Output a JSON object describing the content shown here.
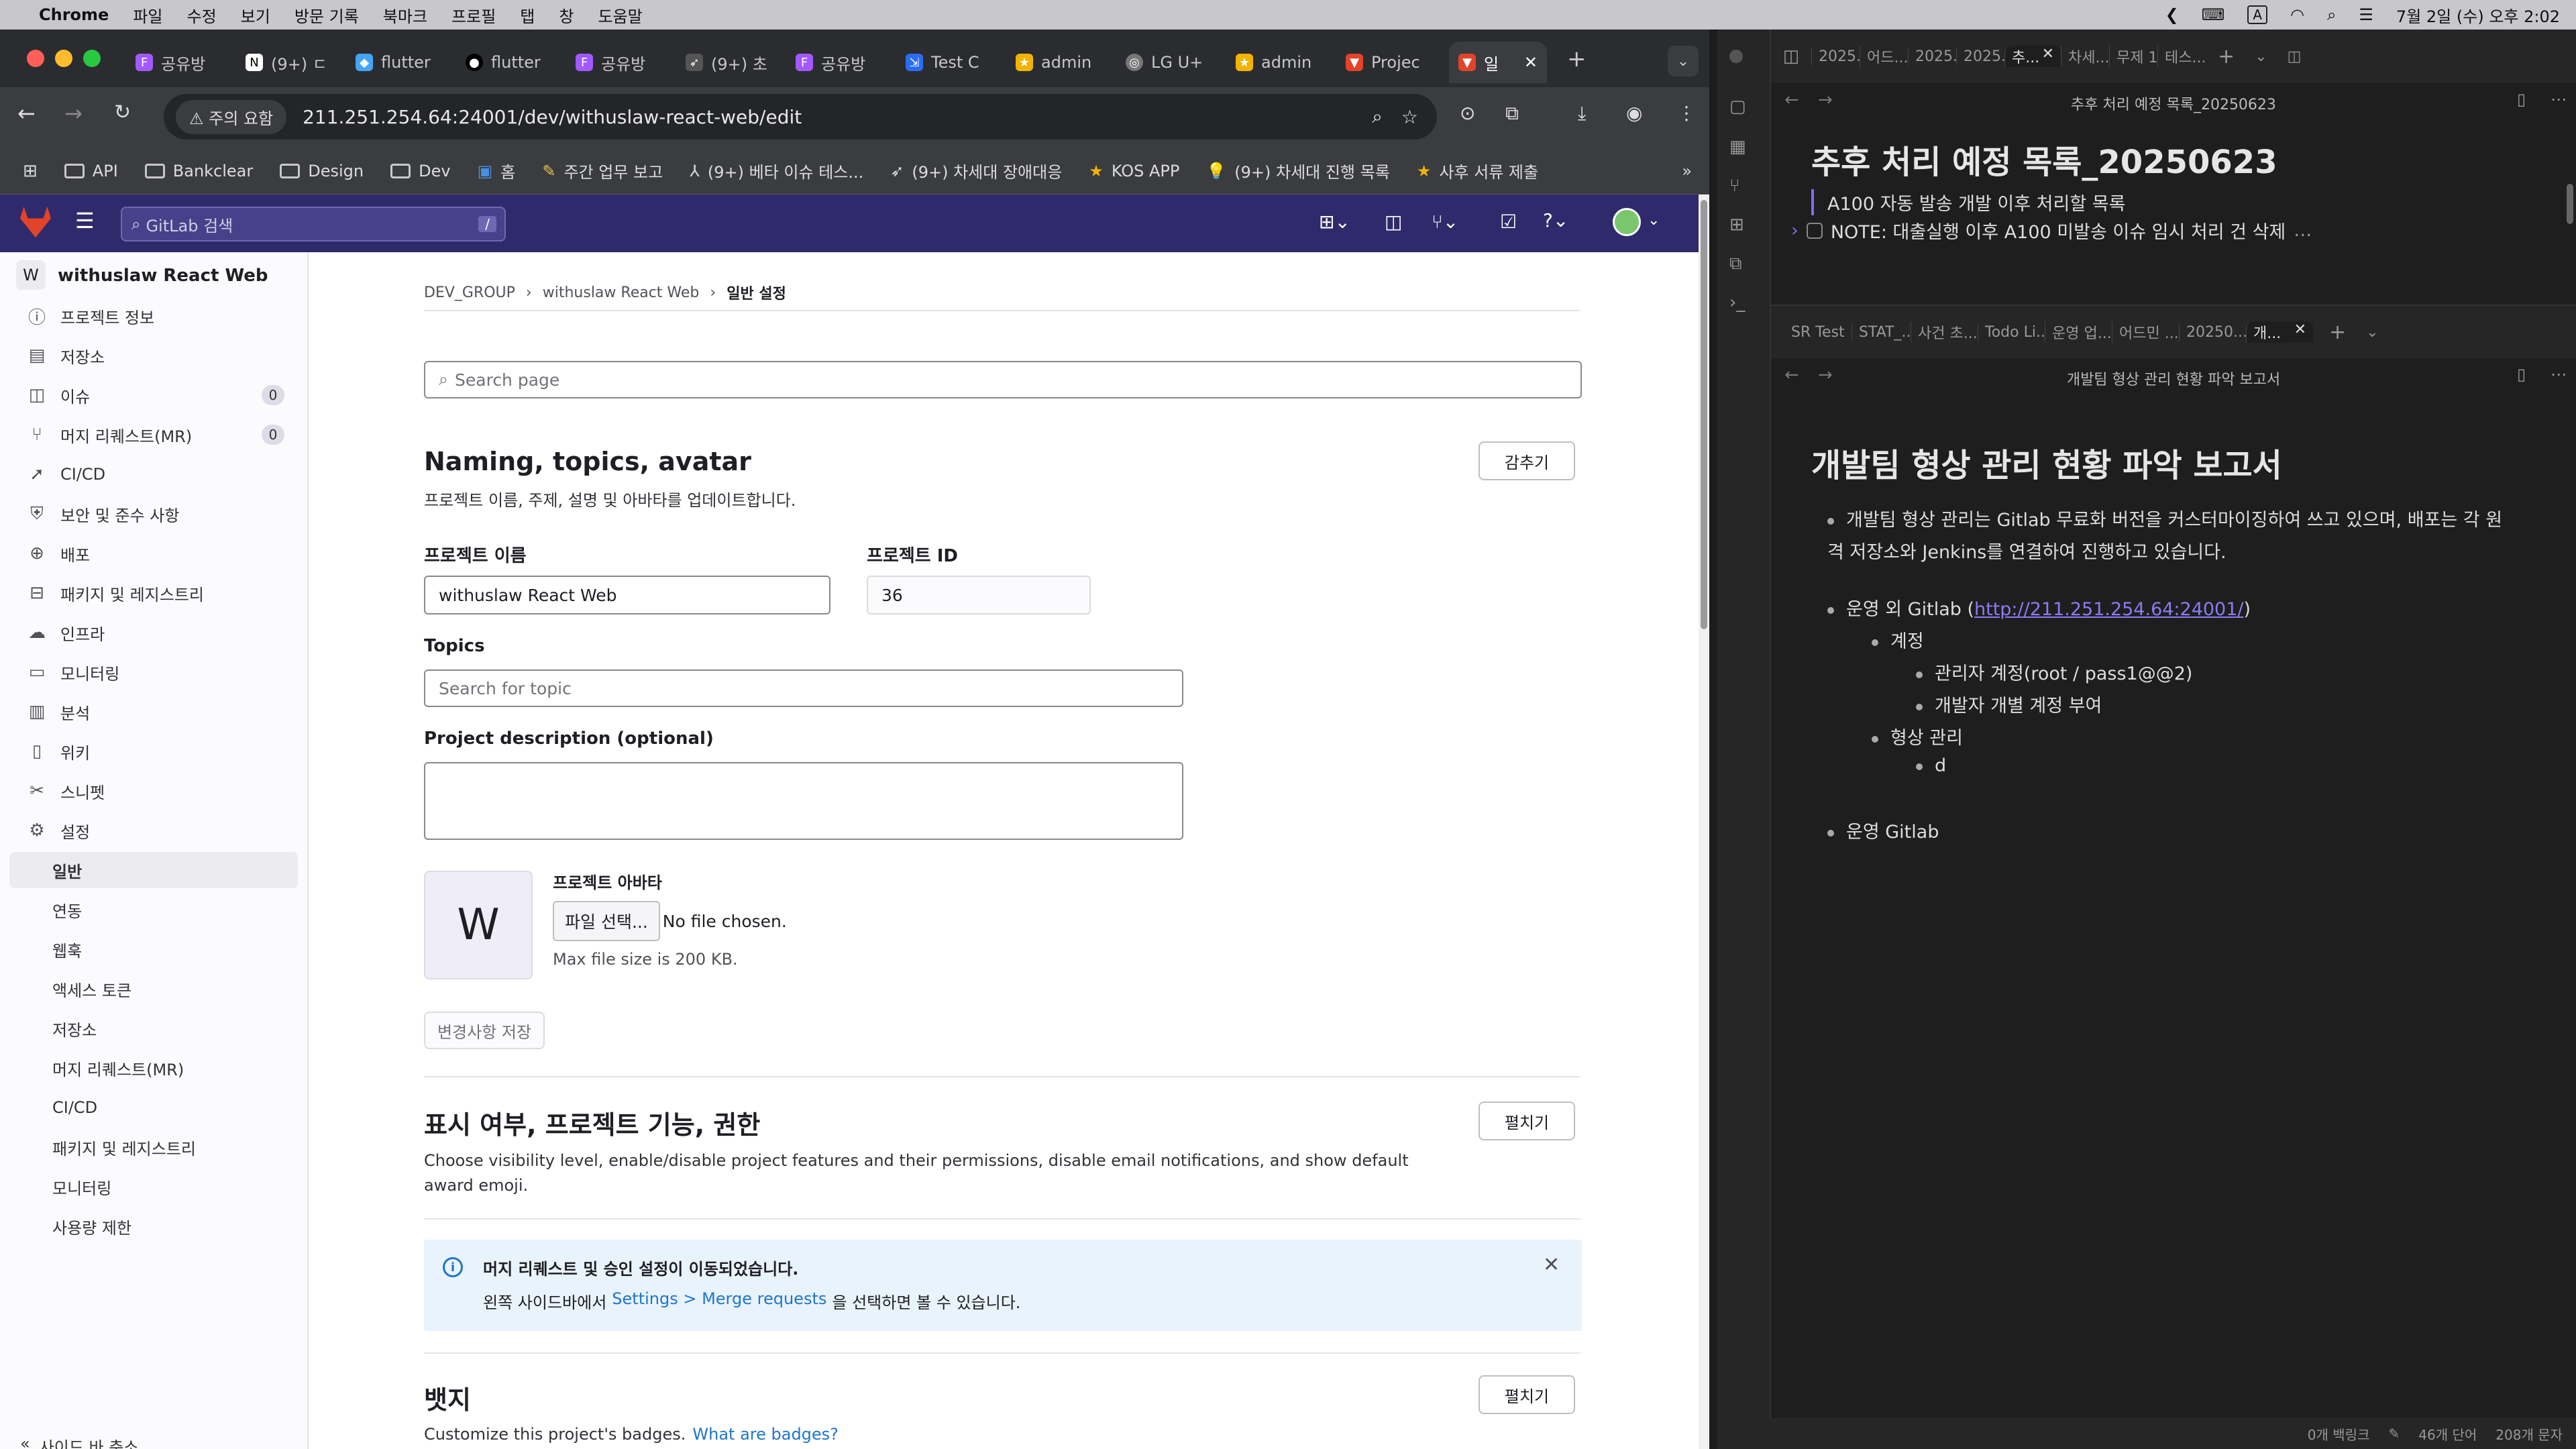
{
  "menubar": {
    "app": "Chrome",
    "items": [
      "파일",
      "수정",
      "보기",
      "방문 기록",
      "북마크",
      "프로필",
      "탭",
      "창",
      "도움말"
    ],
    "clock": "7월 2일 (수) 오후 2:02"
  },
  "chrome": {
    "tabs": [
      "공유방",
      "(9+) ㄷ",
      "flutter",
      "flutter",
      "공유방",
      "(9+) 초",
      "공유방",
      "Test C",
      "admin",
      "LG U+",
      "admin",
      "Projec",
      "일"
    ],
    "url": "211.251.254.64:24001/dev/withuslaw-react-web/edit",
    "warning": "주의 요함",
    "bookmarks": [
      "API",
      "Bankclear",
      "Design",
      "Dev",
      "홈",
      "주간 업무 보고",
      "(9+) 베타 이슈 테스...",
      "(9+) 차세대 장애대응",
      "KOS APP",
      "(9+) 차세대 진행 목록",
      "사후 서류 제출"
    ]
  },
  "gitlab": {
    "search_placeholder": "GitLab 검색",
    "search_shortcut": "/",
    "project_initial": "W",
    "project_name": "withuslaw React Web",
    "nav": [
      {
        "label": "프로젝트 정보",
        "icon": "info-icon"
      },
      {
        "label": "저장소",
        "icon": "file-icon"
      },
      {
        "label": "이슈",
        "icon": "issues-icon",
        "count": "0"
      },
      {
        "label": "머지 리퀘스트(MR)",
        "icon": "merge-request-icon",
        "count": "0"
      },
      {
        "label": "CI/CD",
        "icon": "rocket-icon"
      },
      {
        "label": "보안 및 준수 사항",
        "icon": "shield-icon"
      },
      {
        "label": "배포",
        "icon": "deploy-icon"
      },
      {
        "label": "패키지 및 레지스트리",
        "icon": "package-icon"
      },
      {
        "label": "인프라",
        "icon": "cloud-icon"
      },
      {
        "label": "모니터링",
        "icon": "monitor-icon"
      },
      {
        "label": "분석",
        "icon": "chart-icon"
      },
      {
        "label": "위키",
        "icon": "book-icon"
      },
      {
        "label": "스니펫",
        "icon": "snippet-icon"
      },
      {
        "label": "설정",
        "icon": "settings-icon"
      }
    ],
    "settings_sub": [
      "일반",
      "연동",
      "웹훅",
      "액세스 토큰",
      "저장소",
      "머지 리퀘스트(MR)",
      "CI/CD",
      "패키지 및 레지스트리",
      "모니터링",
      "사용량 제한"
    ],
    "collapse_sidebar": "사이드 바 축소",
    "breadcrumb": [
      "DEV_GROUP",
      "withuslaw React Web",
      "일반 설정"
    ],
    "search_page_placeholder": "Search page",
    "naming": {
      "title": "Naming, topics, avatar",
      "desc": "프로젝트 이름, 주제, 설명 및 아바타를 업데이트합니다.",
      "collapse": "감추기",
      "name_label": "프로젝트 이름",
      "name_value": "withuslaw React Web",
      "id_label": "프로젝트 ID",
      "id_value": "36",
      "topics_label": "Topics",
      "topics_placeholder": "Search for topic",
      "desc_label": "Project description (optional)",
      "avatar_label": "프로젝트 아바타",
      "avatar_initial": "W",
      "choose_file": "파일 선택...",
      "no_file": "No file chosen.",
      "max_size": "Max file size is 200 KB.",
      "save": "변경사항 저장"
    },
    "visibility": {
      "title": "표시 여부, 프로젝트 기능, 권한",
      "desc": "Choose visibility level, enable/disable project features and their permissions, disable email notifications, and show default award emoji.",
      "expand": "펼치기"
    },
    "alert": {
      "title": "머지 리퀘스트 및 승인 설정이 이동되었습니다.",
      "text_pre": "왼쪽 사이드바에서",
      "link": "Settings > Merge requests",
      "text_post": "을 선택하면 볼 수 있습니다."
    },
    "badges": {
      "title": "뱃지",
      "desc": "Customize this project's badges.",
      "link": "What are badges?",
      "expand": "펼치기"
    }
  },
  "obsidian": {
    "top_tabs": [
      "2025...",
      "어드...",
      "2025...",
      "2025...",
      "추...",
      "차세...",
      "무제 1",
      "테스..."
    ],
    "top_note_title": "추후 처리 예정 목록_20250623",
    "top_heading": "추후 처리 예정 목록_20250623",
    "top_quote": "A100 자동 발송 개발 이후 처리할 목록",
    "top_task": "NOTE: 대출실행 이후 A100 미발송 이슈 임시 처리 건 삭제",
    "bottom_tabs": [
      "SR Test",
      "STAT_...",
      "사건 초...",
      "Todo Li...",
      "운영 업...",
      "어드민 ...",
      "20250...",
      "개..."
    ],
    "bottom_note_title": "개발팀 형상 관리 현황 파악 보고서",
    "bottom_heading": "개발팀 형상 관리 현황 파악 보고서",
    "b1": "개발팀 형상 관리는 Gitlab 무료화 버전을 커스터마이징하여 쓰고 있으며, 배포는 각 원격 저장소와 Jenkins를 연결하여 진행하고 있습니다.",
    "b2_pre": "운영 외 Gitlab (",
    "b2_link": "http://211.251.254.64:24001/",
    "b2_post": ")",
    "b2a": "계정",
    "b2a1": "관리자 계정(root / pass1@@2)",
    "b2a2": "개발자 개별 계정 부여",
    "b2b": "형상 관리",
    "b2b1": "d",
    "b3": "운영 Gitlab",
    "status": [
      "0개 백링크",
      "46개 단어",
      "208개 문자"
    ]
  }
}
